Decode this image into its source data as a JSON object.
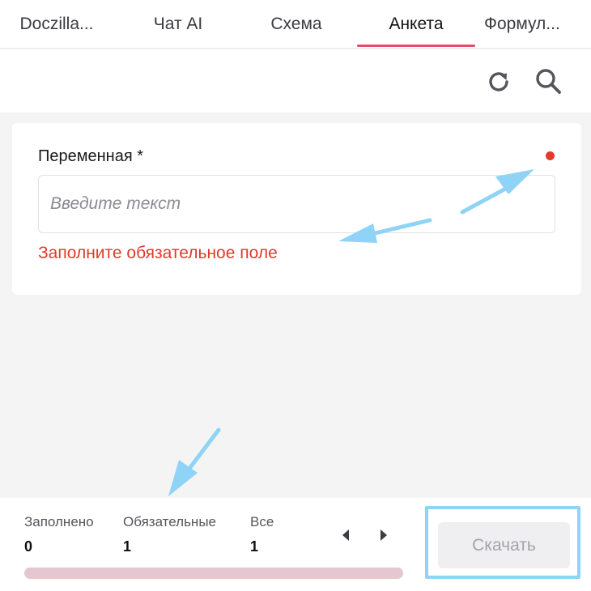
{
  "tabs": [
    {
      "label": "Doczilla..."
    },
    {
      "label": "Чат AI"
    },
    {
      "label": "Схема"
    },
    {
      "label": "Анкета",
      "active": true
    },
    {
      "label": "Формул..."
    }
  ],
  "toolbar": {
    "refresh_icon": "refresh-icon",
    "search_icon": "search-icon"
  },
  "form": {
    "field_label": "Переменная *",
    "input_value": "",
    "input_placeholder": "Введите текст",
    "error_message": "Заполните обязательное поле"
  },
  "footer": {
    "stats": [
      {
        "label": "Заполнено",
        "value": "0"
      },
      {
        "label": "Обязательные",
        "value": "1"
      },
      {
        "label": "Все",
        "value": "1"
      }
    ],
    "progress_fraction": 0,
    "download_label": "Скачать"
  },
  "colors": {
    "accent": "#e0506a",
    "error": "#e13a2c",
    "progress_track": "#e6c6cf",
    "annotation": "#8fd3f7"
  }
}
